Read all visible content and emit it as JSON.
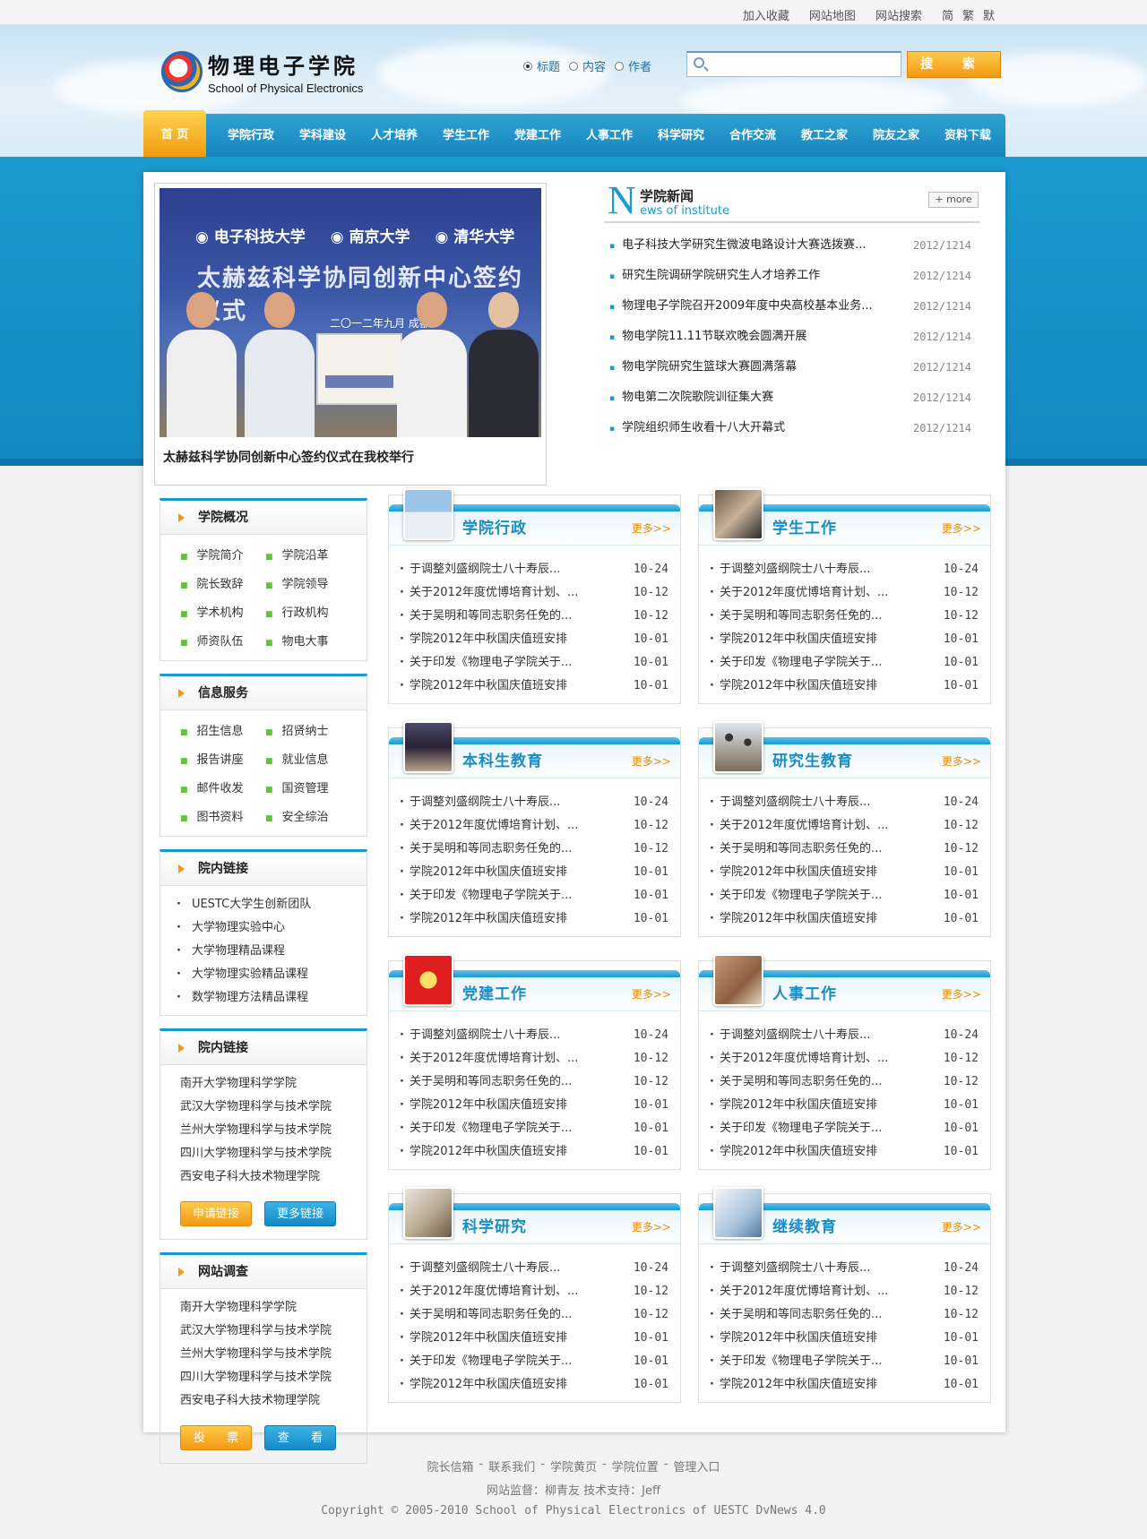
{
  "toplinks": [
    "加入收藏",
    "网站地图",
    "网站搜索"
  ],
  "lang": [
    "简",
    "繁",
    "默"
  ],
  "logo": {
    "cn": "物理电子学院",
    "en": "School of Physical Electronics"
  },
  "search": {
    "options": [
      {
        "label": "标题",
        "checked": true
      },
      {
        "label": "内容",
        "checked": false
      },
      {
        "label": "作者",
        "checked": false
      }
    ],
    "value": "",
    "button": "搜 索"
  },
  "nav": [
    "首 页",
    "学院行政",
    "学科建设",
    "人才培养",
    "学生工作",
    "党建工作",
    "人事工作",
    "科学研究",
    "合作交流",
    "教工之家",
    "院友之家",
    "资料下载"
  ],
  "featured": {
    "unis": [
      "电子科技大学",
      "南京大学",
      "清华大学"
    ],
    "banner": "太赫兹科学协同创新中心签约仪式",
    "date": "二〇一二年九月 成都",
    "caption": "太赫兹科学协同创新中心签约仪式在我校举行"
  },
  "news": {
    "title": "学院新闻",
    "subtitle": "ews of institute",
    "letter": "N",
    "more": "+ more",
    "items": [
      {
        "t": "电子科技大学研究生微波电路设计大赛选拨赛...",
        "d": "2012/1214"
      },
      {
        "t": "研究生院调研学院研究生人才培养工作",
        "d": "2012/1214"
      },
      {
        "t": "物理电子学院召开2009年度中央高校基本业务...",
        "d": "2012/1214"
      },
      {
        "t": "物电学院11.11节联欢晚会圆满开展",
        "d": "2012/1214"
      },
      {
        "t": "物电学院研究生篮球大赛圆满落幕",
        "d": "2012/1214"
      },
      {
        "t": "物电第二次院歌院训征集大赛",
        "d": "2012/1214"
      },
      {
        "t": "学院组织师生收看十八大开幕式",
        "d": "2012/1214"
      }
    ]
  },
  "sidebar": {
    "overview": {
      "title": "学院概况",
      "items": [
        "学院简介",
        "学院沿革",
        "院长致辞",
        "学院领导",
        "学术机构",
        "行政机构",
        "师资队伍",
        "物电大事"
      ]
    },
    "service": {
      "title": "信息服务",
      "items": [
        "招生信息",
        "招贤纳士",
        "报告讲座",
        "就业信息",
        "邮件收发",
        "国资管理",
        "图书资料",
        "安全综治"
      ]
    },
    "links_out": {
      "title": "院内链接",
      "items": [
        "UESTC大学生创新团队",
        "大学物理实验中心",
        "大学物理精品课程",
        "大学物理实验精品课程",
        "数学物理方法精品课程"
      ]
    },
    "links_in": {
      "title": "院内链接",
      "items": [
        "南开大学物理科学学院",
        "武汉大学物理科学与技术学院",
        "兰州大学物理科学与技术学院",
        "四川大学物理科学与技术学院",
        "西安电子科大技术物理学院"
      ],
      "btn1": "申请链接",
      "btn2": "更多链接"
    },
    "survey": {
      "title": "网站调查",
      "items": [
        "南开大学物理科学学院",
        "武汉大学物理科学与技术学院",
        "兰州大学物理科学与技术学院",
        "四川大学物理科学与技术学院",
        "西安电子科大技术物理学院"
      ],
      "btn1": "投 票",
      "btn2": "查 看"
    }
  },
  "modules": [
    {
      "title": "学院行政",
      "icon": "building-photo-icon"
    },
    {
      "title": "学生工作",
      "icon": "students-photo-icon"
    },
    {
      "title": "本科生教育",
      "icon": "graduates-photo-icon"
    },
    {
      "title": "研究生教育",
      "icon": "caps-photo-icon"
    },
    {
      "title": "党建工作",
      "icon": "party-emblem-icon"
    },
    {
      "title": "人事工作",
      "icon": "handshake-photo-icon"
    },
    {
      "title": "科学研究",
      "icon": "research-photo-icon"
    },
    {
      "title": "继续教育",
      "icon": "laptop-photo-icon"
    }
  ],
  "module_more": "更多>>",
  "module_items": [
    {
      "t": "于调整刘盛纲院士八十寿辰...",
      "d": "10-24"
    },
    {
      "t": "关于2012年度优博培育计划、...",
      "d": "10-12"
    },
    {
      "t": "关于吴明和等同志职务任免的...",
      "d": "10-12"
    },
    {
      "t": "学院2012年中秋国庆值班安排",
      "d": "10-01"
    },
    {
      "t": "关于印发《物理电子学院关于...",
      "d": "10-01"
    },
    {
      "t": "学院2012年中秋国庆值班安排",
      "d": "10-01"
    }
  ],
  "footer": {
    "links": [
      "院长信箱",
      "-",
      "联系我们",
      "-",
      "学院黄页",
      "-",
      "学院位置",
      "-",
      "管理入口"
    ],
    "monitor": "网站监督：柳青友   技术支持：Jeff",
    "copyright": "Copyright © 2005-2010 School of Physical Electronics of UESTC DvNews 4.0"
  },
  "colors": {
    "brand_blue": "#1a9ad2",
    "accent_orange": "#f39a12"
  }
}
